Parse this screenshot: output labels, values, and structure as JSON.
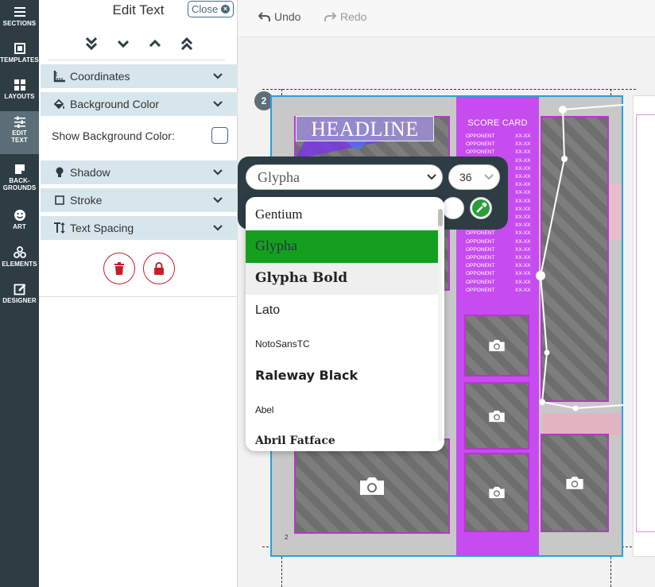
{
  "nav": {
    "items": [
      {
        "label": "SECTIONS",
        "icon": "hamburger-icon"
      },
      {
        "label": "TEMPLATES",
        "icon": "templates-icon"
      },
      {
        "label": "LAYOUTS",
        "icon": "grid-icon"
      },
      {
        "label": "EDIT\nTEXT",
        "icon": "sliders-icon"
      },
      {
        "label": "BACK-\nGROUNDS",
        "icon": "background-icon"
      },
      {
        "label": "ART",
        "icon": "smiley-icon"
      },
      {
        "label": "ELEMENTS",
        "icon": "shapes-icon"
      },
      {
        "label": "DESIGNER",
        "icon": "edit-icon"
      }
    ]
  },
  "panel": {
    "title": "Edit Text",
    "close_label": "Close",
    "sections": {
      "coordinates": "Coordinates",
      "background_color": "Background Color",
      "show_background_label": "Show Background Color:",
      "shadow": "Shadow",
      "stroke": "Stroke",
      "text_spacing": "Text Spacing"
    }
  },
  "toolbar": {
    "undo": "Undo",
    "redo": "Redo"
  },
  "canvas": {
    "page_number": "2",
    "corner_number": "2",
    "headline": "HEADLINE",
    "score_card_title": "SCORE CARD",
    "score_rows": [
      {
        "team": "OPPONENT",
        "score": "XX-XX"
      },
      {
        "team": "OPPONENT",
        "score": "XX-XX"
      },
      {
        "team": "OPPONENT",
        "score": "XX-XX"
      },
      {
        "team": "OPPONENT",
        "score": "XX-XX"
      },
      {
        "team": "OPPONENT",
        "score": "XX-XX"
      },
      {
        "team": "OPPONENT",
        "score": "XX-XX"
      },
      {
        "team": "OPPONENT",
        "score": "XX-XX"
      },
      {
        "team": "OPPONENT",
        "score": "XX-XX"
      },
      {
        "team": "OPPONENT",
        "score": "XX-XX"
      },
      {
        "team": "OPPONENT",
        "score": "XX-XX"
      },
      {
        "team": "OPPONENT",
        "score": "XX-XX"
      },
      {
        "team": "OPPONENT",
        "score": "XX-XX"
      },
      {
        "team": "OPPONENT",
        "score": "XX-XX"
      },
      {
        "team": "OPPONENT",
        "score": "XX-XX"
      },
      {
        "team": "OPPONENT",
        "score": "XX-XX"
      },
      {
        "team": "OPPONENT",
        "score": "XX-XX"
      },
      {
        "team": "OPPONENT",
        "score": "XX-XX"
      },
      {
        "team": "OPPONENT",
        "score": "XX-XX"
      },
      {
        "team": "OPPONENT",
        "score": "XX-XX"
      },
      {
        "team": "OPPONENT",
        "score": "XX-XX"
      }
    ]
  },
  "text_tools": {
    "font_value": "Glypha",
    "size_value": "36",
    "font_options": [
      {
        "label": "Gentium",
        "state": "normal"
      },
      {
        "label": "Glypha",
        "state": "selected"
      },
      {
        "label": "Glypha Bold",
        "state": "hover"
      },
      {
        "label": "Lato",
        "state": "normal"
      },
      {
        "label": "NotoSansTC",
        "state": "normal"
      },
      {
        "label": "Raleway Black",
        "state": "normal"
      },
      {
        "label": "Abel",
        "state": "normal"
      },
      {
        "label": "Abril Fatface",
        "state": "normal"
      }
    ]
  },
  "colors": {
    "nav_bg": "#2e3d44",
    "accordion_bg": "#d7e6ec",
    "selected_option": "#14a01e",
    "score_card": "#c64cf0",
    "page_border": "#2aa0d8",
    "danger": "#c81e28"
  }
}
